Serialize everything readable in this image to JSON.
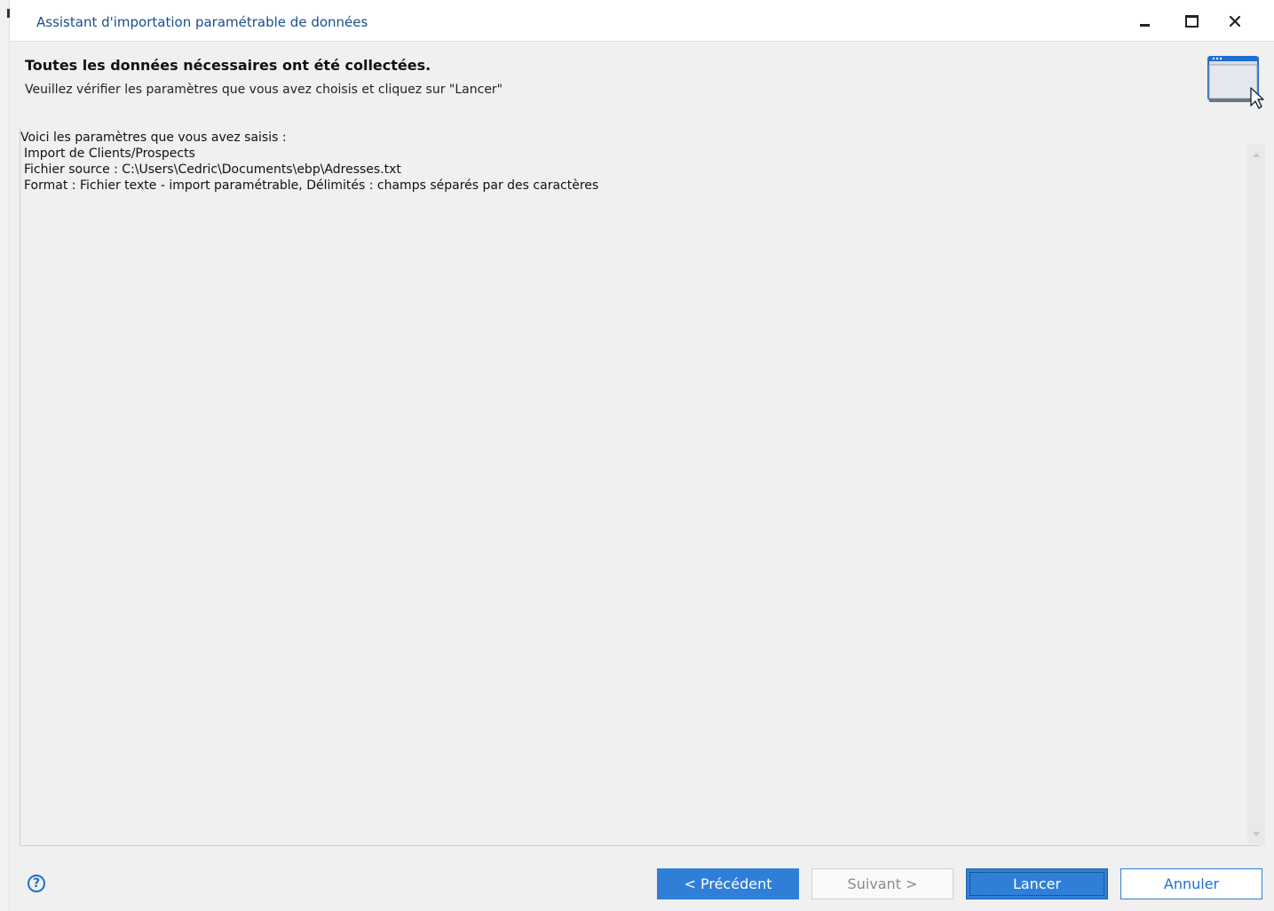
{
  "window": {
    "title": "Assistant d'importation paramétrable de données",
    "controls": [
      "minimize-icon",
      "maximize-icon",
      "close-icon"
    ]
  },
  "header": {
    "title": "Toutes les données nécessaires ont été collectées.",
    "subtitle": "Veuillez vérifier les paramètres que vous avez choisis et cliquez sur \"Lancer\"",
    "icon": "wizard-window-cursor-icon"
  },
  "summary": {
    "intro": "Voici les paramètres que vous avez saisis :",
    "lines": [
      "Import de Clients/Prospects",
      "Fichier source : C:\\Users\\Cedric\\Documents\\ebp\\Adresses.txt",
      "Format : Fichier texte - import paramétrable, Délimités : champs séparés par des caractères"
    ]
  },
  "footer": {
    "help_glyph": "?",
    "buttons": {
      "prev": "< Précédent",
      "next": "Suivant >",
      "launch": "Lancer",
      "cancel": "Annuler"
    }
  },
  "colors": {
    "accent": "#2f7fd8",
    "title_text": "#1a4d8f",
    "panel_background": "#f0f0f0"
  }
}
